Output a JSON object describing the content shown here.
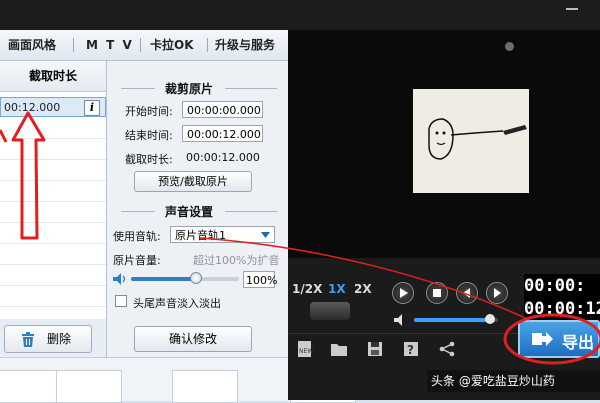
{
  "menu": {
    "items": [
      "画面风格",
      "M T V",
      "卡拉OK",
      "升级与服务"
    ]
  },
  "list": {
    "column_header": "截取时长",
    "selected_time": "00:12.000",
    "info_glyph": "i",
    "delete_label": "删除"
  },
  "clip": {
    "section_title": "裁剪原片",
    "start_label": "开始时间:",
    "start_value": "00:00:00.000",
    "end_label": "结束时间:",
    "end_value": "00:00:12.000",
    "duration_label": "截取时长:",
    "duration_value": "00:00:12.000",
    "preview_button": "预览/截取原片"
  },
  "audio": {
    "section_title": "声音设置",
    "track_label": "使用音轨:",
    "track_value": "原片音轨1",
    "volume_label": "原片音量:",
    "amplify_hint": "超过100%为扩音",
    "volume_percent": "100%",
    "volume_level": 0.6,
    "fade_label": "头尾声音淡入淡出",
    "fade_checked": false,
    "confirm_button": "确认修改"
  },
  "player": {
    "speed_half": "1/2X",
    "speed_1x": "1X",
    "speed_2x": "2X",
    "timecode_top": "00:00:",
    "timecode_bottom": "00:00:12",
    "seek_position": 1.0,
    "volume_level": 0.9,
    "export_label": "导出"
  },
  "watermark": "头条 @爱吃盐豆炒山药",
  "colors": {
    "annotation_red": "#e0201c",
    "selected_speed": "#3aa0ff",
    "export_bg": "#1f7ccc"
  }
}
